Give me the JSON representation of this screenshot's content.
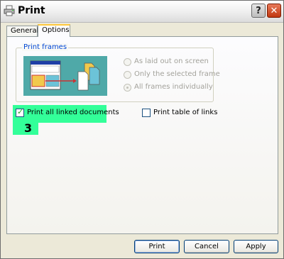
{
  "window": {
    "title": "Print",
    "help_label": "?",
    "close_label": "✕"
  },
  "tabs": [
    {
      "label": "General",
      "selected": false
    },
    {
      "label": "Options",
      "selected": true
    }
  ],
  "print_frames": {
    "legend": "Print frames",
    "options": [
      {
        "label": "As laid out on screen",
        "selected": false,
        "enabled": false
      },
      {
        "label": "Only the selected frame",
        "selected": false,
        "enabled": false
      },
      {
        "label": "All frames individually",
        "selected": true,
        "enabled": false
      }
    ]
  },
  "checkboxes": {
    "linked_documents": {
      "label": "Print all linked documents",
      "checked": true
    },
    "table_of_links": {
      "label": "Print table of links",
      "checked": false
    }
  },
  "callout": {
    "number": "3",
    "color": "#33ff99"
  },
  "buttons": {
    "print": "Print",
    "cancel": "Cancel",
    "apply": "Apply"
  },
  "icons": [
    "printer-icon",
    "help-icon",
    "close-icon",
    "frames-illustration-icon"
  ]
}
